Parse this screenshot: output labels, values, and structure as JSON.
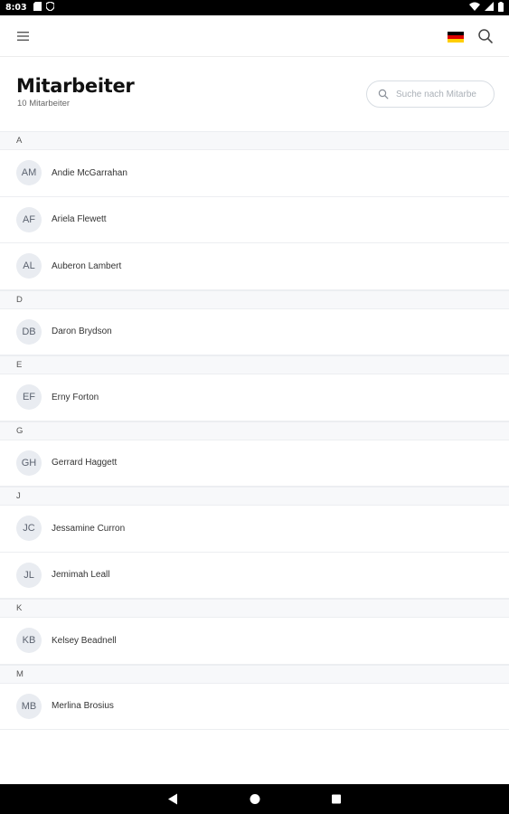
{
  "status_bar": {
    "time": "8:03",
    "icons": [
      "sd-card-icon",
      "shield-icon",
      "wifi-icon",
      "signal-icon",
      "battery-icon"
    ]
  },
  "app_bar": {
    "icons": [
      "hamburger-menu-icon",
      "german-flag-icon",
      "search-icon"
    ],
    "flag_colors": [
      "#000000",
      "#dd0000",
      "#ffce00"
    ]
  },
  "header": {
    "title": "Mitarbeiter",
    "subtitle": "10 Mitarbeiter",
    "search_placeholder": "Suche nach Mitarbe"
  },
  "sections": [
    {
      "letter": "A",
      "employees": [
        {
          "initials": "AM",
          "name": "Andie McGarrahan"
        },
        {
          "initials": "AF",
          "name": "Ariela Flewett"
        },
        {
          "initials": "AL",
          "name": "Auberon Lambert"
        }
      ]
    },
    {
      "letter": "D",
      "employees": [
        {
          "initials": "DB",
          "name": "Daron Brydson"
        }
      ]
    },
    {
      "letter": "E",
      "employees": [
        {
          "initials": "EF",
          "name": "Erny Forton"
        }
      ]
    },
    {
      "letter": "G",
      "employees": [
        {
          "initials": "GH",
          "name": "Gerrard Haggett"
        }
      ]
    },
    {
      "letter": "J",
      "employees": [
        {
          "initials": "JC",
          "name": "Jessamine Curron"
        },
        {
          "initials": "JL",
          "name": "Jemimah Leall"
        }
      ]
    },
    {
      "letter": "K",
      "employees": [
        {
          "initials": "KB",
          "name": "Kelsey Beadnell"
        }
      ]
    },
    {
      "letter": "M",
      "employees": [
        {
          "initials": "MB",
          "name": "Merlina Brosius"
        }
      ]
    }
  ],
  "nav_bar": {
    "icons": [
      "back-icon",
      "home-icon",
      "recents-icon"
    ]
  }
}
